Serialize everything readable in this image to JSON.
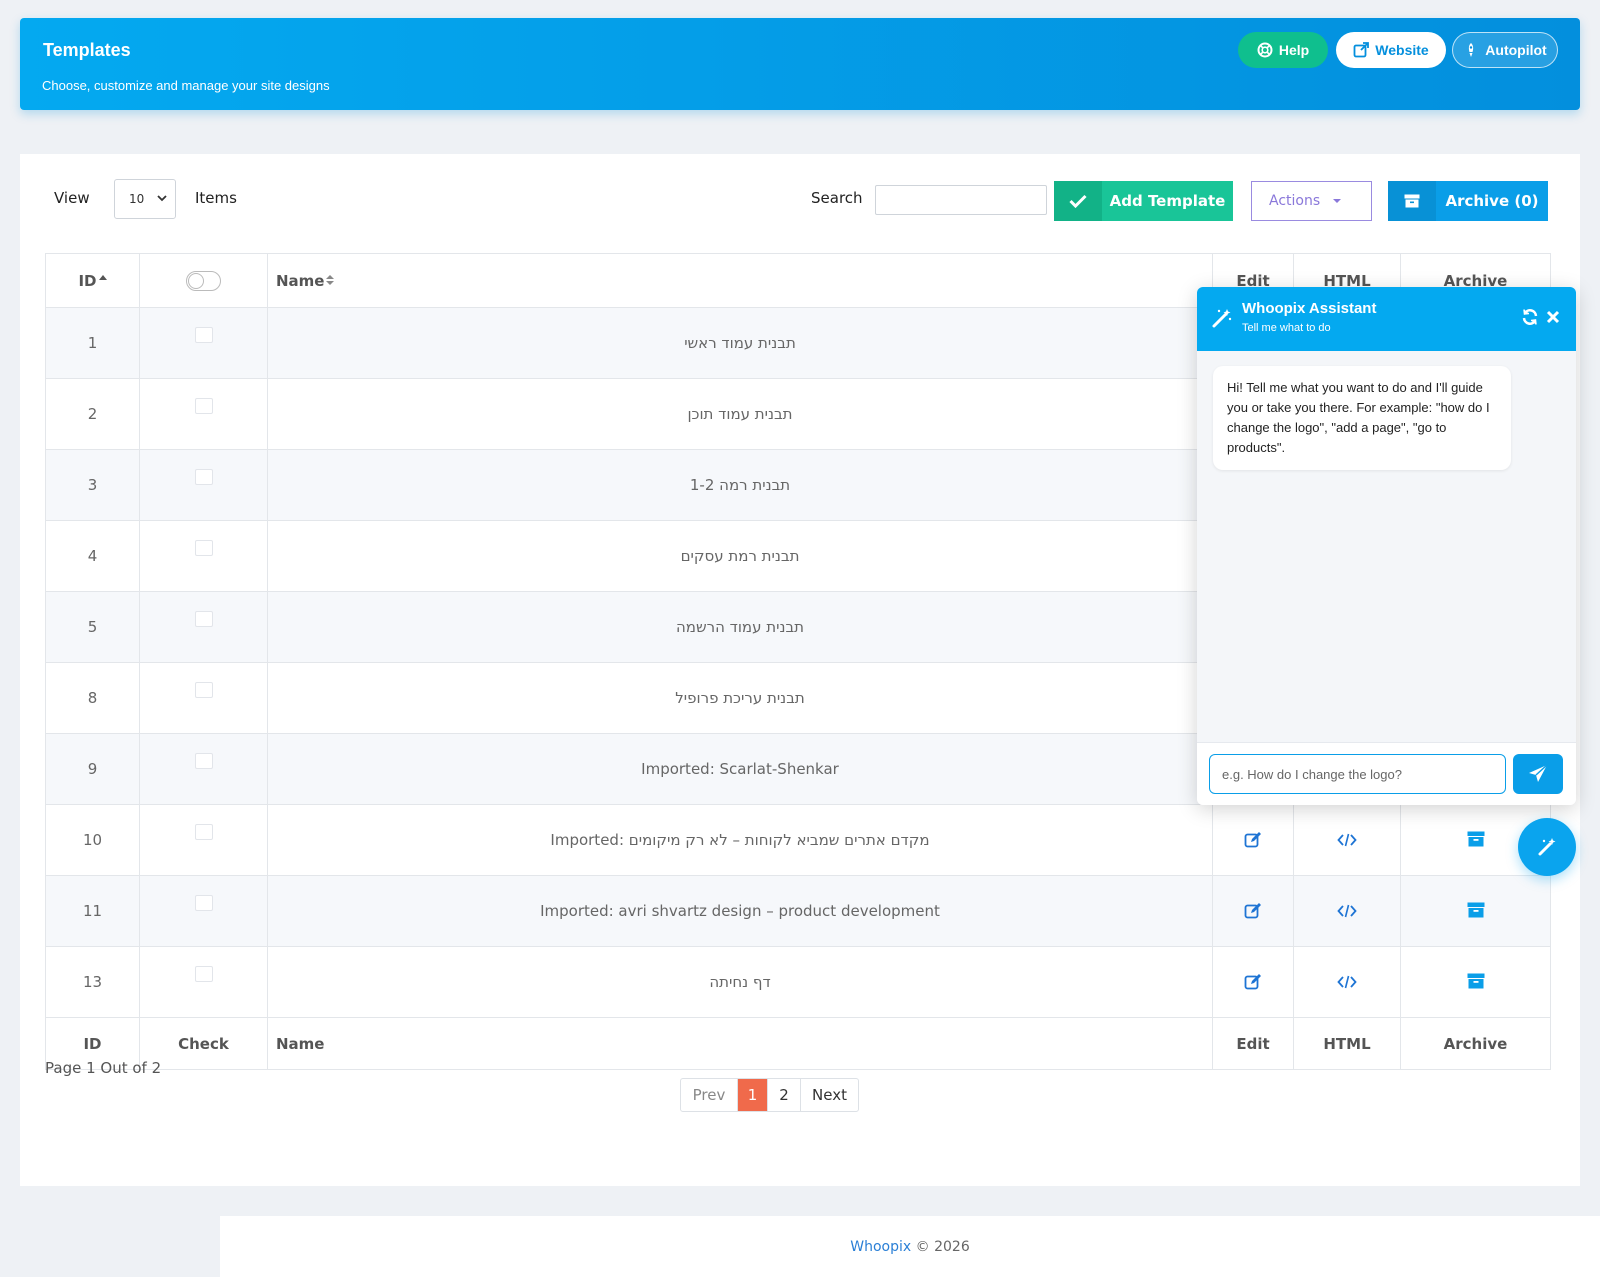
{
  "header": {
    "title": "Templates",
    "subtitle": "Choose, customize and manage your site designs",
    "buttons": {
      "help": "Help",
      "website": "Website",
      "autopilot": "Autopilot"
    }
  },
  "toolbar": {
    "view_label": "View",
    "view_value": "10",
    "items_label": "Items",
    "search_label": "Search",
    "search_value": "",
    "add_label": "Add Template",
    "actions_label": "Actions",
    "archive_label": "Archive (0)"
  },
  "table": {
    "headers": {
      "id": "ID",
      "name": "Name",
      "edit": "Edit",
      "html": "HTML",
      "archive": "Archive"
    },
    "footers": {
      "id": "ID",
      "check": "Check",
      "name": "Name",
      "edit": "Edit",
      "html": "HTML",
      "archive": "Archive"
    },
    "rows": [
      {
        "id": "1",
        "name": "תבנית עמוד ראשי"
      },
      {
        "id": "2",
        "name": "תבנית עמוד תוכן"
      },
      {
        "id": "3",
        "name": "תבנית רמה 1-2"
      },
      {
        "id": "4",
        "name": "תבנית רמת עסקים"
      },
      {
        "id": "5",
        "name": "תבנית עמוד הרשמה"
      },
      {
        "id": "8",
        "name": "תבנית עריכת פרופיל"
      },
      {
        "id": "9",
        "name": "Imported: Scarlat-Shenkar"
      },
      {
        "id": "10",
        "name": "Imported: מקדם אתרים שמביא לקוחות – לא רק מיקומים"
      },
      {
        "id": "11",
        "name": "Imported: avri shvartz design – product development"
      },
      {
        "id": "13",
        "name": "דף נחיתה"
      }
    ]
  },
  "pagination": {
    "info": "Page 1 Out of 2",
    "prev": "Prev",
    "pages": [
      "1",
      "2"
    ],
    "next": "Next",
    "current": "1"
  },
  "footer": {
    "brand": "Whoopix",
    "copyright": "© 2026"
  },
  "assistant": {
    "title": "Whoopix Assistant",
    "subtitle": "Tell me what to do",
    "message": "Hi! Tell me what you want to do and I'll guide you or take you there. For example: \"how do I change the logo\", \"add a page\", \"go to products\".",
    "input_placeholder": "e.g. How do I change the logo?"
  },
  "colors": {
    "brand_blue": "#04a9f0",
    "green": "#19c598",
    "purple": "#8a78da",
    "active_page": "#f06a4b"
  },
  "icons": {
    "help": "lifebuoy-icon",
    "website": "external-link-icon",
    "autopilot": "rocket-icon",
    "add": "check-icon",
    "archive": "archive-box-icon",
    "edit": "edit-icon",
    "html": "code-icon",
    "assistant": "magic-wand-icon",
    "refresh": "refresh-icon",
    "close": "close-icon",
    "send": "paper-plane-icon"
  }
}
